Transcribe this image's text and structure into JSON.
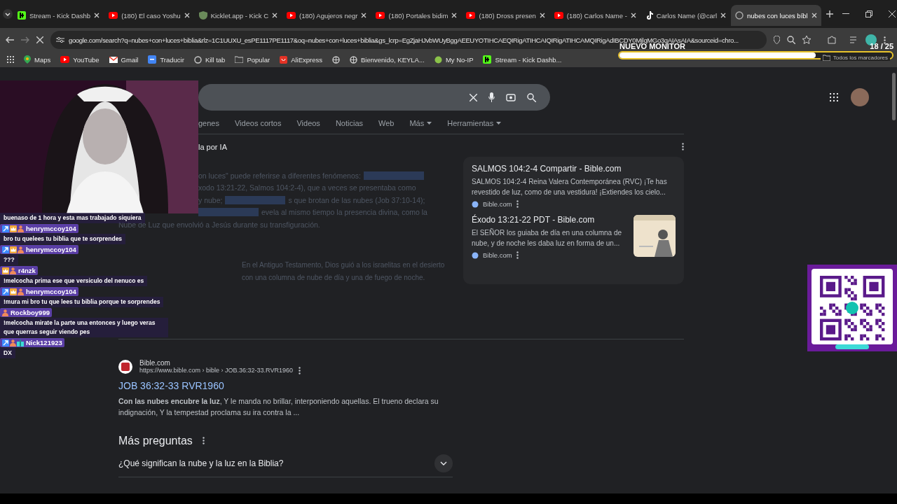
{
  "tabs": [
    {
      "label": "Stream - Kick Dashb",
      "kind": "kick",
      "selected": false
    },
    {
      "label": "(180) El caso Yoshu",
      "kind": "youtube",
      "selected": false
    },
    {
      "label": "Kicklet.app - Kick C",
      "kind": "kicklet",
      "selected": false
    },
    {
      "label": "(180) Agujeros negr",
      "kind": "youtube",
      "selected": false
    },
    {
      "label": "(180) Portales bidim",
      "kind": "youtube",
      "selected": false
    },
    {
      "label": "(180) Dross presen",
      "kind": "youtube",
      "selected": false
    },
    {
      "label": "(180) Carlos Name -",
      "kind": "youtube",
      "selected": false
    },
    {
      "label": "Carlos Name (@carl",
      "kind": "tiktok",
      "selected": false
    },
    {
      "label": "nubes con luces bíbl",
      "kind": "google",
      "selected": true
    }
  ],
  "address_bar": {
    "url": "google.com/search?q=nubes+con+luces+biblia&rlz=1C1UUXU_esPE1117PE1117&oq=nubes+con+luces+biblia&gs_lcrp=EgZjaHJvbWUyBggAEEUYOTIHCAEQIRigATIHCAIQIRigATIHCAMQIRigAdIBCDY0MjlqMGo3qAIAsAIA&sourceid=chro..."
  },
  "bookmarks": [
    {
      "label": "Maps",
      "kind": "maps"
    },
    {
      "label": "YouTube",
      "kind": "youtube"
    },
    {
      "label": "Gmail",
      "kind": "gmail"
    },
    {
      "label": "Traducir",
      "kind": "translate"
    },
    {
      "label": "Kill tab",
      "kind": "kill"
    },
    {
      "label": "Popular",
      "kind": "folder"
    },
    {
      "label": "AliExpress",
      "kind": "aliexpress"
    },
    {
      "kind": "globe"
    },
    {
      "label": "Bienvenido, KEYLA...",
      "kind": "globe"
    },
    {
      "label": "My No-IP",
      "kind": "noip"
    },
    {
      "label": "Stream - Kick Dashb...",
      "kind": "kick"
    }
  ],
  "all_bookmarks": "Todos los marcadores",
  "goal_overlay": {
    "title": "NUEVO MONITOR",
    "count": "18 / 25",
    "level": 0.72
  },
  "search_tabs": [
    {
      "label": "genes",
      "dropdown": false
    },
    {
      "label": "Videos cortos",
      "dropdown": false
    },
    {
      "label": "Videos",
      "dropdown": false
    },
    {
      "label": "Noticias",
      "dropdown": false
    },
    {
      "label": "Web",
      "dropdown": false
    },
    {
      "label": "Más",
      "dropdown": true
    },
    {
      "label": "Herramientas",
      "dropdown": true
    }
  ],
  "ai_overview": {
    "heading": "la por IA",
    "lines": [
      {
        "indent": true,
        "segments": [
          {
            "kind": "text",
            "text": "on luces\" puede referirse a diferentes fenómenos:"
          },
          {
            "kind": "highlight"
          }
        ]
      },
      {
        "indent": true,
        "segments": [
          {
            "kind": "text",
            "text": "xodo 13:21-22, Salmos 104:2-4), que a veces se presentaba como"
          }
        ]
      },
      {
        "indent": true,
        "segments": [
          {
            "kind": "text",
            "text": "y nube;"
          },
          {
            "kind": "highlight"
          },
          {
            "kind": "text",
            "text": "s que brotan de las nubes (Job 37:10-14);"
          }
        ]
      },
      {
        "indent": true,
        "segments": [
          {
            "kind": "highlight"
          },
          {
            "kind": "text",
            "text": "evela al mismo tiempo la presencia divina, como la"
          }
        ]
      },
      {
        "indent": false,
        "segments": [
          {
            "kind": "text",
            "text": "Nube de Luz que envolvió a Jesús durante su transfiguración."
          }
        ]
      }
    ],
    "bullet": "En el Antiguo Testamento, Dios guió a los israelitas en el desierto con una columna de nube de día y una de fuego de noche."
  },
  "source_cards": [
    {
      "title": "SALMOS 104:2-4 Compartir - Bible.com",
      "snippet": "SALMOS 104:2-4 Reina Valera Contemporánea (RVC) ¡Te has revestido de luz, como de una vestidura! ¡Extiendes los cielo...",
      "site": "Bible.com",
      "thumbnail": false
    },
    {
      "title": "Éxodo 13:21-22 PDT - Bible.com",
      "snippet": "El SEÑOR los guiaba de día en una columna de nube, y de noche les daba luz en forma de un...",
      "site": "Bible.com",
      "thumbnail": true
    }
  ],
  "result": {
    "site": "Bible.com",
    "url": "https://www.bible.com › bible › JOB.36:32-33.RVR1960",
    "title": "JOB 36:32-33 RVR1960",
    "snippet": "**Con las nubes encubre la luz**, Y le manda no brillar, interponiendo aquellas. El trueno declara su indignación, Y la tempestad proclama su ira contra la ..."
  },
  "more_questions": {
    "heading": "Más preguntas",
    "questions": [
      {
        "text": "¿Qué significan la nube y la luz en la Biblia?",
        "expanded": false
      }
    ]
  },
  "chat": [
    {
      "text": "buenaso de 1 hora y esta mas trabajado siquiera"
    },
    {
      "user": "henrymccoy104",
      "badges": [
        {
          "kind": "arrow"
        },
        {
          "kind": "crown"
        },
        {
          "kind": "figure"
        }
      ],
      "text": "bro tu quelees tu biblia que te sorprendes"
    },
    {
      "user": "henrymccoy104",
      "badges": [
        {
          "kind": "arrow"
        },
        {
          "kind": "crown"
        },
        {
          "kind": "figure"
        }
      ],
      "text": "???"
    },
    {
      "user": "r4nzk",
      "badges": [
        {
          "kind": "crown"
        },
        {
          "kind": "figure"
        }
      ],
      "text": "!melcocha prima ese que versiculo del nenuco es"
    },
    {
      "user": "henrymccoy104",
      "badges": [
        {
          "kind": "arrow"
        },
        {
          "kind": "crown"
        },
        {
          "kind": "figure"
        }
      ],
      "text": "!mura mi bro tu que lees tu biblia porque te sorprendes"
    },
    {
      "user": "Rockboy999",
      "badges": [
        {
          "kind": "figure"
        }
      ],
      "text": "!melcocha mirate la parte una entonces y luego veras que querras seguir viendo pes"
    },
    {
      "user": "Nick121923",
      "badges": [
        {
          "kind": "arrow"
        },
        {
          "kind": "figure"
        },
        {
          "kind": "gift"
        }
      ],
      "text": "DX"
    }
  ]
}
